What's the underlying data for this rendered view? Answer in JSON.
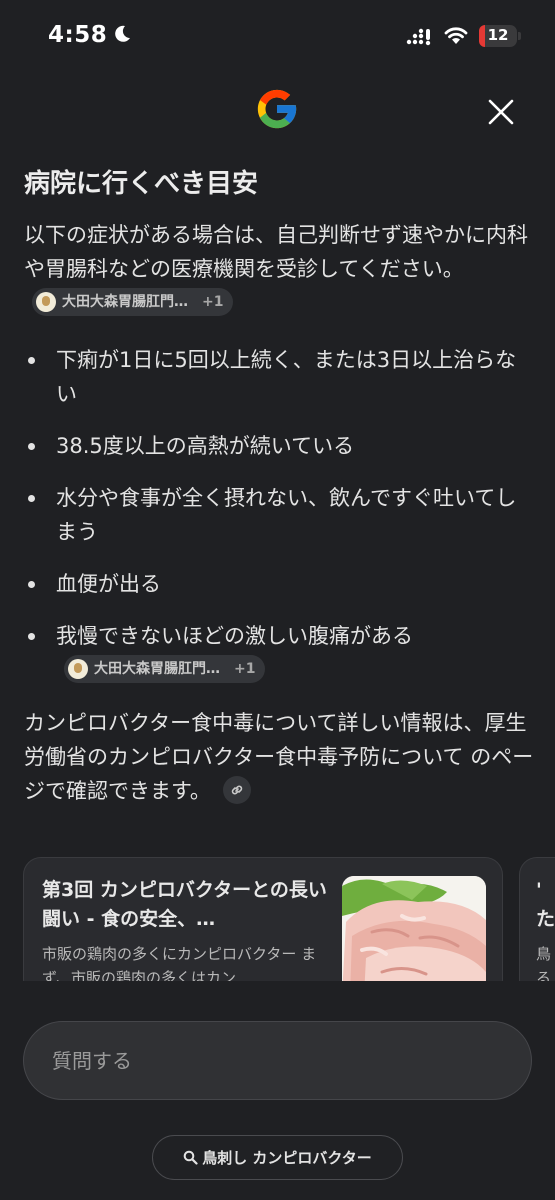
{
  "status_bar": {
    "time": "4:58",
    "battery_level": "12",
    "moon_icon": "moon-icon",
    "signal_icon": "signal-icon",
    "wifi_icon": "wifi-icon",
    "battery_color": "#e53935"
  },
  "header": {
    "logo_icon": "google-g-icon",
    "close_icon": "close-icon"
  },
  "content": {
    "heading": "病院に行くべき目安",
    "intro": "以下の症状がある場合は、自己判断せず速やかに内科や胃腸科などの医療機関を受診してください。",
    "source_chip": {
      "source": "大田大森胃腸肛門…",
      "more": "+1"
    },
    "bullets": [
      "下痢が1日に5回以上続く、または3日以上治らない",
      "38.5度以上の高熱が続いている",
      "水分や食事が全く摂れない、飲んですぐ吐いてしまう",
      "血便が出る",
      "我慢できないほどの激しい腹痛がある"
    ],
    "bullet_source_chip": {
      "source": "大田大森胃腸肛門…",
      "more": "+1"
    },
    "closing": "カンピロバクター食中毒について詳しい情報は、厚生労働省のカンピロバクター食中毒予防について のページで確認できます。",
    "link_icon": "link-icon"
  },
  "cards": [
    {
      "title": "第3回 カンピロバクターとの長い闘い - 食の安全、…",
      "snippet": "市販の鶏肉の多くにカンピロバクター まず、市販の鶏肉の多くはカン…",
      "thumbnail": "raw-chicken-image"
    },
    {
      "title_partial": "'\nた",
      "snippet_partial": "鳥\nる"
    }
  ],
  "ask": {
    "placeholder": "質問する"
  },
  "query_chip": {
    "label": "鳥刺し カンピロバクター",
    "icon": "search-icon"
  }
}
